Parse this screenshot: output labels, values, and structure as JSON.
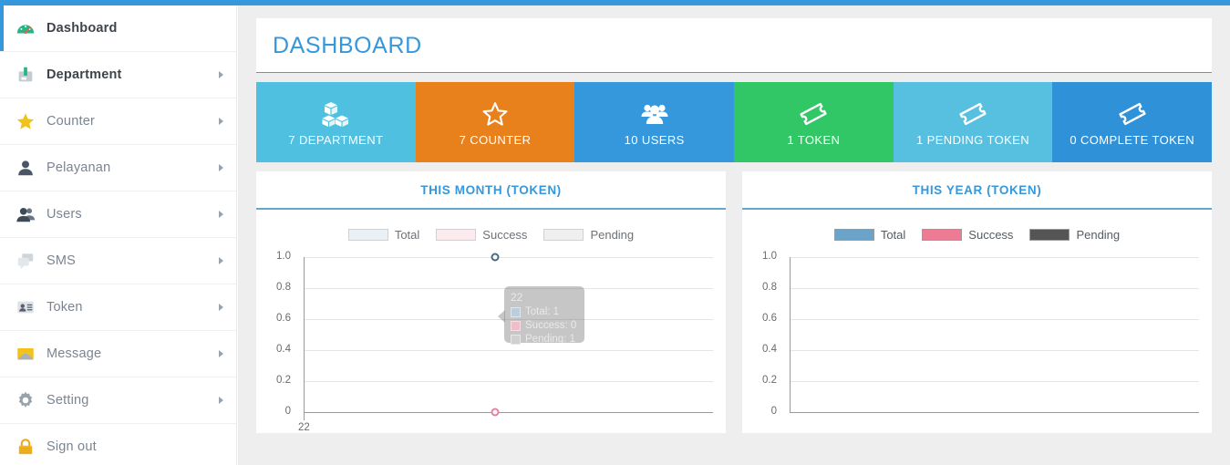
{
  "brand": {
    "accent": "#3598dc"
  },
  "sidebar": {
    "items": [
      {
        "label": "Dashboard",
        "icon": "speedometer-icon",
        "active": true,
        "caret": false
      },
      {
        "label": "Department",
        "icon": "department-icon",
        "active": false,
        "caret": true,
        "bold": true
      },
      {
        "label": "Counter",
        "icon": "star-icon",
        "active": false,
        "caret": true
      },
      {
        "label": "Pelayanan",
        "icon": "user-icon",
        "active": false,
        "caret": true
      },
      {
        "label": "Users",
        "icon": "users-icon",
        "active": false,
        "caret": true
      },
      {
        "label": "SMS",
        "icon": "chat-icon",
        "active": false,
        "caret": true
      },
      {
        "label": "Token",
        "icon": "id-card-icon",
        "active": false,
        "caret": true
      },
      {
        "label": "Message",
        "icon": "envelope-icon",
        "active": false,
        "caret": true
      },
      {
        "label": "Setting",
        "icon": "gear-icon",
        "active": false,
        "caret": true
      },
      {
        "label": "Sign out",
        "icon": "lock-icon",
        "active": false,
        "caret": false
      }
    ]
  },
  "page": {
    "title": "DASHBOARD"
  },
  "tiles": [
    {
      "label": "7 DEPARTMENT",
      "icon": "boxes-icon",
      "color": "#4fc0e0"
    },
    {
      "label": "7 COUNTER",
      "icon": "star-icon",
      "color": "#e8801c"
    },
    {
      "label": "10 USERS",
      "icon": "users-icon",
      "color": "#3598dc"
    },
    {
      "label": "1 TOKEN",
      "icon": "ticket-icon",
      "color": "#32c766"
    },
    {
      "label": "1 PENDING TOKEN",
      "icon": "ticket-icon",
      "color": "#57bfe0"
    },
    {
      "label": "0 COMPLETE TOKEN",
      "icon": "ticket-icon",
      "color": "#2f92d8"
    }
  ],
  "panels": [
    {
      "title": "THIS MONTH (TOKEN)",
      "faded": true,
      "tooltip": {
        "title": "22",
        "rows": [
          {
            "label": "Total: 1",
            "color": "#b9cfe0"
          },
          {
            "label": "Success: 0",
            "color": "#f0bdc8"
          },
          {
            "label": "Pending: 1",
            "color": "#d0d0d0"
          }
        ]
      }
    },
    {
      "title": "THIS YEAR (TOKEN)",
      "faded": false,
      "tooltip": null
    }
  ],
  "chart_data": [
    {
      "type": "scatter",
      "title": "THIS MONTH (TOKEN)",
      "categories": [
        "22"
      ],
      "x": [
        "22"
      ],
      "series": [
        {
          "name": "Total",
          "color": "#6ba4c8",
          "values": [
            1
          ]
        },
        {
          "name": "Success",
          "color": "#ee7b94",
          "values": [
            0
          ]
        },
        {
          "name": "Pending",
          "color": "#555555",
          "values": [
            1
          ]
        }
      ],
      "xlabel": "",
      "ylabel": "",
      "ylim": [
        0,
        1.0
      ],
      "yticks": [
        "1.0",
        "0.8",
        "0.6",
        "0.4",
        "0.2",
        "0"
      ],
      "xticks": [
        "22"
      ],
      "grid": true,
      "legend": "top-center",
      "legend_entries": [
        "Total",
        "Success",
        "Pending"
      ],
      "annotation": "22 — Total: 1, Success: 0, Pending: 1"
    },
    {
      "type": "scatter",
      "title": "THIS YEAR (TOKEN)",
      "categories": [],
      "x": [],
      "series": [
        {
          "name": "Total",
          "color": "#6ba4c8",
          "values": []
        },
        {
          "name": "Success",
          "color": "#ee7b94",
          "values": []
        },
        {
          "name": "Pending",
          "color": "#555555",
          "values": []
        }
      ],
      "xlabel": "",
      "ylabel": "",
      "ylim": [
        0,
        1.0
      ],
      "yticks": [
        "1.0",
        "0.8",
        "0.6",
        "0.4",
        "0.2",
        "0"
      ],
      "xticks": [],
      "grid": true,
      "legend": "top-center",
      "legend_entries": [
        "Total",
        "Success",
        "Pending"
      ]
    }
  ]
}
